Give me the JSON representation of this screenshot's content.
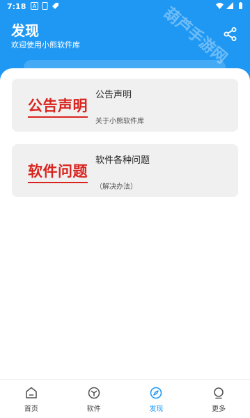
{
  "status_bar": {
    "time": "7:18"
  },
  "header": {
    "title": "发现",
    "subtitle": "欢迎使用小熊软件库",
    "watermark": "葫芦手游网"
  },
  "cards": [
    {
      "thumb_text": "公告声明",
      "title": "公告声明",
      "subtitle": "关于小熊软件库"
    },
    {
      "thumb_text": "软件问题",
      "title": "软件各种问题",
      "subtitle": "（解决办法）"
    }
  ],
  "bottom_nav": {
    "items": [
      {
        "label": "首页",
        "icon": "home-icon",
        "active": false
      },
      {
        "label": "软件",
        "icon": "box-icon",
        "active": false
      },
      {
        "label": "发现",
        "icon": "compass-icon",
        "active": true
      },
      {
        "label": "更多",
        "icon": "more-icon",
        "active": false
      }
    ]
  },
  "colors": {
    "primary": "#1f98f4",
    "thumb_red": "#d8241f",
    "card_bg": "#f0f0f0"
  }
}
